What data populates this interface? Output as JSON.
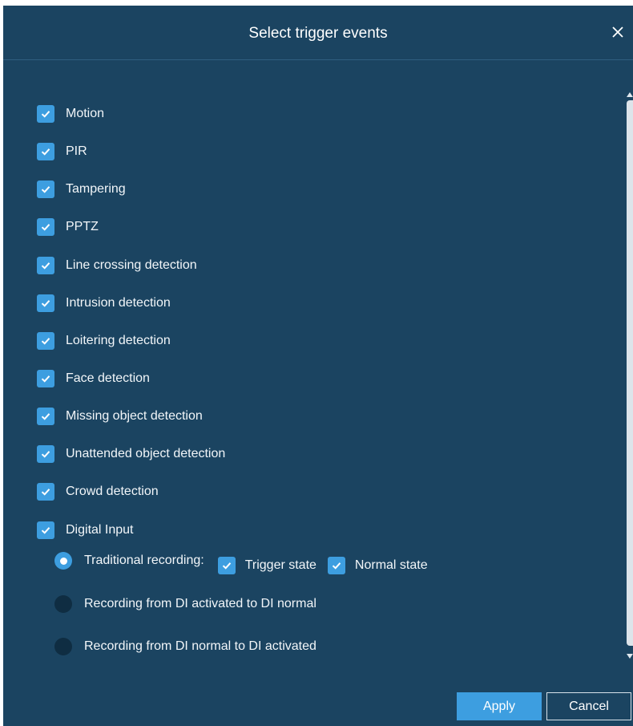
{
  "dialog": {
    "title": "Select trigger events",
    "close_icon": "close-icon"
  },
  "events": [
    {
      "label": "Motion",
      "checked": true
    },
    {
      "label": "PIR",
      "checked": true
    },
    {
      "label": "Tampering",
      "checked": true
    },
    {
      "label": "PPTZ",
      "checked": true
    },
    {
      "label": "Line crossing detection",
      "checked": true
    },
    {
      "label": "Intrusion detection",
      "checked": true
    },
    {
      "label": "Loitering detection",
      "checked": true
    },
    {
      "label": "Face detection",
      "checked": true
    },
    {
      "label": "Missing object detection",
      "checked": true
    },
    {
      "label": "Unattended object detection",
      "checked": true
    },
    {
      "label": "Crowd detection",
      "checked": true
    },
    {
      "label": "Digital Input",
      "checked": true
    }
  ],
  "digital_input_modes": [
    {
      "label": "Traditional recording:",
      "selected": true
    },
    {
      "label": "Recording from DI activated to DI normal",
      "selected": false
    },
    {
      "label": "Recording from DI normal to DI activated",
      "selected": false
    }
  ],
  "traditional_options": [
    {
      "label": "Trigger state",
      "checked": true
    },
    {
      "label": "Normal state",
      "checked": true
    }
  ],
  "buttons": {
    "apply": "Apply",
    "cancel": "Cancel"
  },
  "colors": {
    "background": "#1b4461",
    "accent": "#3d9ee0",
    "radio_off": "#0f2d42"
  }
}
